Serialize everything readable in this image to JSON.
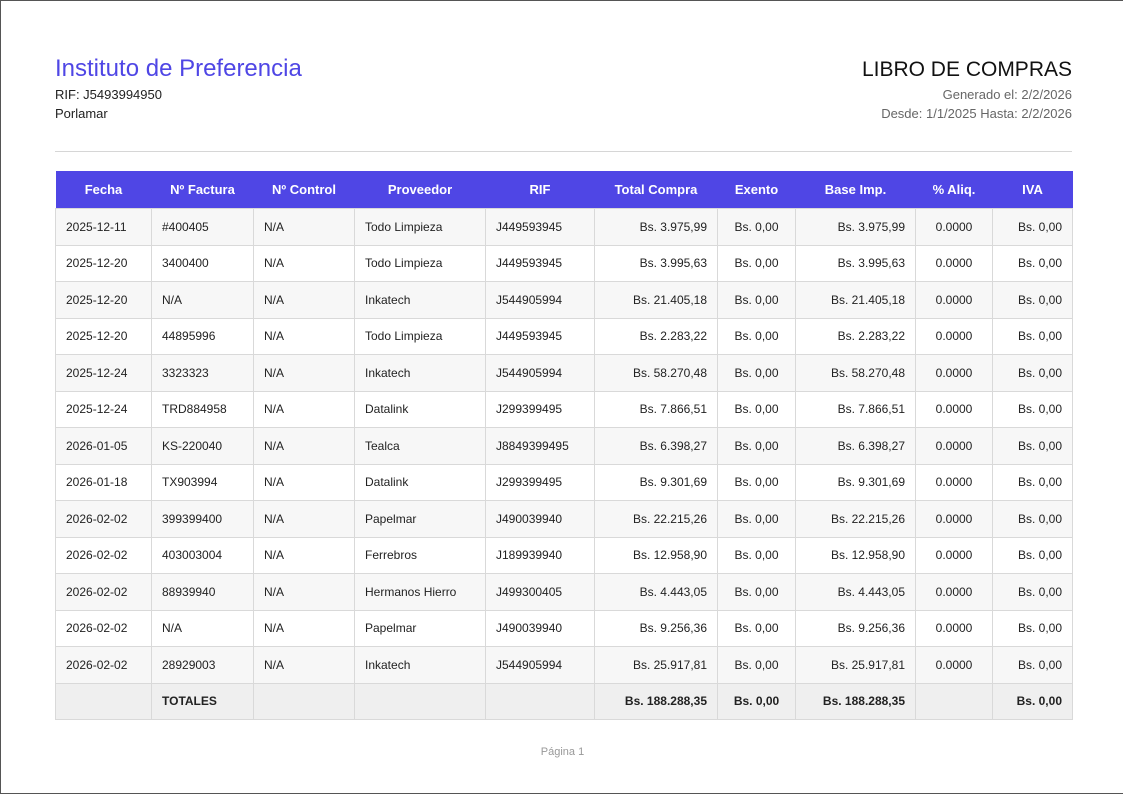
{
  "company": {
    "name": "Instituto de Preferencia",
    "rif": "RIF: J5493994950",
    "city": "Porlamar"
  },
  "report": {
    "title": "LIBRO DE COMPRAS",
    "generated": "Generado el: 2/2/2026",
    "range": "Desde: 1/1/2025  Hasta: 2/2/2026"
  },
  "colors": {
    "accent": "#4f46e5"
  },
  "table": {
    "headers": [
      "Fecha",
      "Nº Factura",
      "Nº Control",
      "Proveedor",
      "RIF",
      "Total Compra",
      "Exento",
      "Base Imp.",
      "% Aliq.",
      "IVA"
    ],
    "rows": [
      [
        "2025-12-11",
        "#400405",
        "N/A",
        "Todo Limpieza",
        "J449593945",
        "Bs. 3.975,99",
        "Bs. 0,00",
        "Bs. 3.975,99",
        "0.0000",
        "Bs. 0,00"
      ],
      [
        "2025-12-20",
        "3400400",
        "N/A",
        "Todo Limpieza",
        "J449593945",
        "Bs. 3.995,63",
        "Bs. 0,00",
        "Bs. 3.995,63",
        "0.0000",
        "Bs. 0,00"
      ],
      [
        "2025-12-20",
        "N/A",
        "N/A",
        "Inkatech",
        "J544905994",
        "Bs. 21.405,18",
        "Bs. 0,00",
        "Bs. 21.405,18",
        "0.0000",
        "Bs. 0,00"
      ],
      [
        "2025-12-20",
        "44895996",
        "N/A",
        "Todo Limpieza",
        "J449593945",
        "Bs. 2.283,22",
        "Bs. 0,00",
        "Bs. 2.283,22",
        "0.0000",
        "Bs. 0,00"
      ],
      [
        "2025-12-24",
        "3323323",
        "N/A",
        "Inkatech",
        "J544905994",
        "Bs. 58.270,48",
        "Bs. 0,00",
        "Bs. 58.270,48",
        "0.0000",
        "Bs. 0,00"
      ],
      [
        "2025-12-24",
        "TRD884958",
        "N/A",
        "Datalink",
        "J299399495",
        "Bs. 7.866,51",
        "Bs. 0,00",
        "Bs. 7.866,51",
        "0.0000",
        "Bs. 0,00"
      ],
      [
        "2026-01-05",
        "KS-220040",
        "N/A",
        "Tealca",
        "J8849399495",
        "Bs. 6.398,27",
        "Bs. 0,00",
        "Bs. 6.398,27",
        "0.0000",
        "Bs. 0,00"
      ],
      [
        "2026-01-18",
        "TX903994",
        "N/A",
        "Datalink",
        "J299399495",
        "Bs. 9.301,69",
        "Bs. 0,00",
        "Bs. 9.301,69",
        "0.0000",
        "Bs. 0,00"
      ],
      [
        "2026-02-02",
        "399399400",
        "N/A",
        "Papelmar",
        "J490039940",
        "Bs. 22.215,26",
        "Bs. 0,00",
        "Bs. 22.215,26",
        "0.0000",
        "Bs. 0,00"
      ],
      [
        "2026-02-02",
        "403003004",
        "N/A",
        "Ferrebros",
        "J189939940",
        "Bs. 12.958,90",
        "Bs. 0,00",
        "Bs. 12.958,90",
        "0.0000",
        "Bs. 0,00"
      ],
      [
        "2026-02-02",
        "88939940",
        "N/A",
        "Hermanos Hierro",
        "J499300405",
        "Bs. 4.443,05",
        "Bs. 0,00",
        "Bs. 4.443,05",
        "0.0000",
        "Bs. 0,00"
      ],
      [
        "2026-02-02",
        "N/A",
        "N/A",
        "Papelmar",
        "J490039940",
        "Bs. 9.256,36",
        "Bs. 0,00",
        "Bs. 9.256,36",
        "0.0000",
        "Bs. 0,00"
      ],
      [
        "2026-02-02",
        "28929003",
        "N/A",
        "Inkatech",
        "J544905994",
        "Bs. 25.917,81",
        "Bs. 0,00",
        "Bs. 25.917,81",
        "0.0000",
        "Bs. 0,00"
      ]
    ],
    "totals": {
      "label": "TOTALES",
      "total_compra": "Bs. 188.288,35",
      "exento": "Bs. 0,00",
      "base_imp": "Bs. 188.288,35",
      "iva": "Bs. 0,00"
    }
  },
  "footer": {
    "page": "Página 1"
  }
}
